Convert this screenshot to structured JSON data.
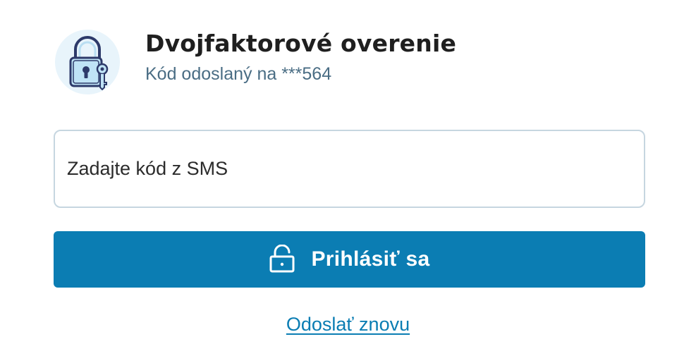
{
  "header": {
    "icon": "padlock-with-key-icon",
    "title": "Dvojfaktorové overenie",
    "subtitle": "Kód odoslaný na ***564"
  },
  "code_field": {
    "placeholder": "Zadajte kód z SMS",
    "value": ""
  },
  "login_button": {
    "icon": "unlock-icon",
    "label": "Prihlásiť sa"
  },
  "resend_link": {
    "label": "Odoslať znovu"
  },
  "colors": {
    "accent": "#0b7db3",
    "title_text": "#1f1f1f",
    "subtitle_text": "#4a6d84",
    "input_border": "#c6d6e0",
    "icon_badge_background": "#e8f4fb"
  }
}
